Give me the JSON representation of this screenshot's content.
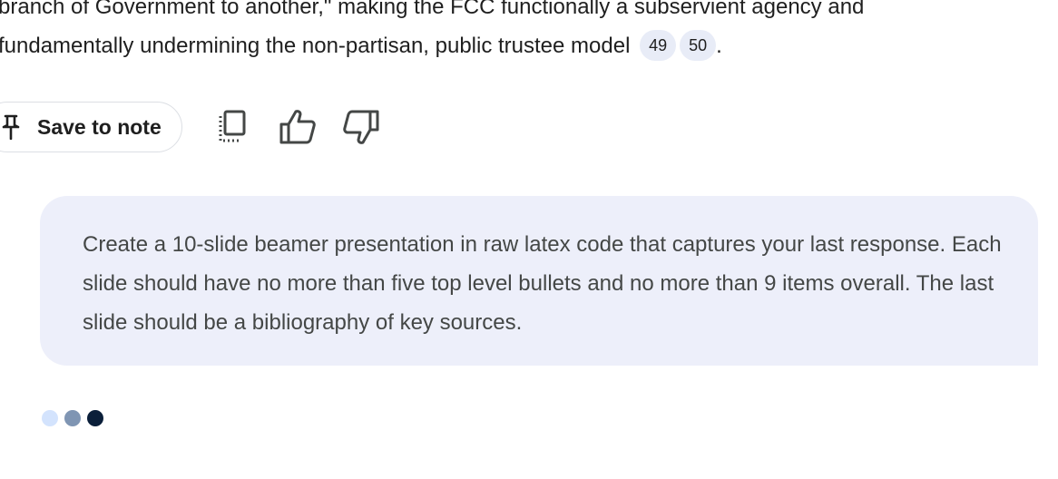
{
  "response": {
    "line1": "branch of Government to another,\" making the FCC functionally a subservient agency and",
    "line2": "fundamentally undermining the non-partisan, public trustee model",
    "citations": [
      "49",
      "50"
    ],
    "trailing": "."
  },
  "actions": {
    "save_label": "Save to note",
    "icons": [
      "pin-icon",
      "copy-icon",
      "thumbs-up-icon",
      "thumbs-down-icon"
    ]
  },
  "prompt": {
    "text": "Create a 10-slide beamer presentation in raw latex code that captures your last response. Each slide should have no more than five top level bullets and no more than 9 items overall. The last slide should be a bibliography of key sources."
  },
  "loading_indicator": {
    "colors": [
      "#d3e3fd",
      "#7f95b3",
      "#0b1f3a"
    ]
  }
}
